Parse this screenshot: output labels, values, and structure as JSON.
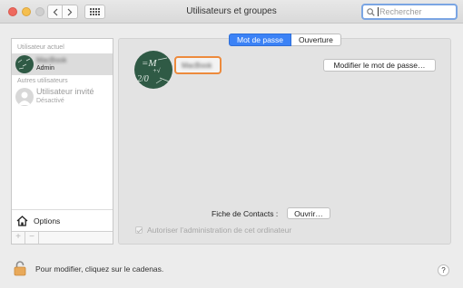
{
  "window": {
    "title": "Utilisateurs et groupes"
  },
  "search": {
    "placeholder": "Rechercher"
  },
  "sidebar": {
    "current_section": "Utilisateur actuel",
    "current_user": {
      "name": "MacBook",
      "role": "Admin"
    },
    "other_section": "Autres utilisateurs",
    "guest_user": {
      "name": "Utilisateur invité",
      "status": "Désactivé"
    },
    "options_label": "Options",
    "add_label": "+",
    "remove_label": "−"
  },
  "tabs": [
    {
      "label": "Mot de passe",
      "active": true
    },
    {
      "label": "Ouverture",
      "active": false
    }
  ],
  "user_panel": {
    "full_name": "MacBook",
    "change_password_label": "Modifier le mot de passe…",
    "contacts_label": "Fiche de Contacts :",
    "open_label": "Ouvrir…",
    "allow_admin_label": "Autoriser l’administration de cet ordinateur",
    "allow_admin_checked": true
  },
  "footer": {
    "lock_text": "Pour modifier, cliquez sur le cadenas.",
    "help_label": "?"
  },
  "colors": {
    "accent": "#3b82f6",
    "name_focus_ring": "#ed8a3c",
    "avatar_bg": "#2f5a45"
  }
}
